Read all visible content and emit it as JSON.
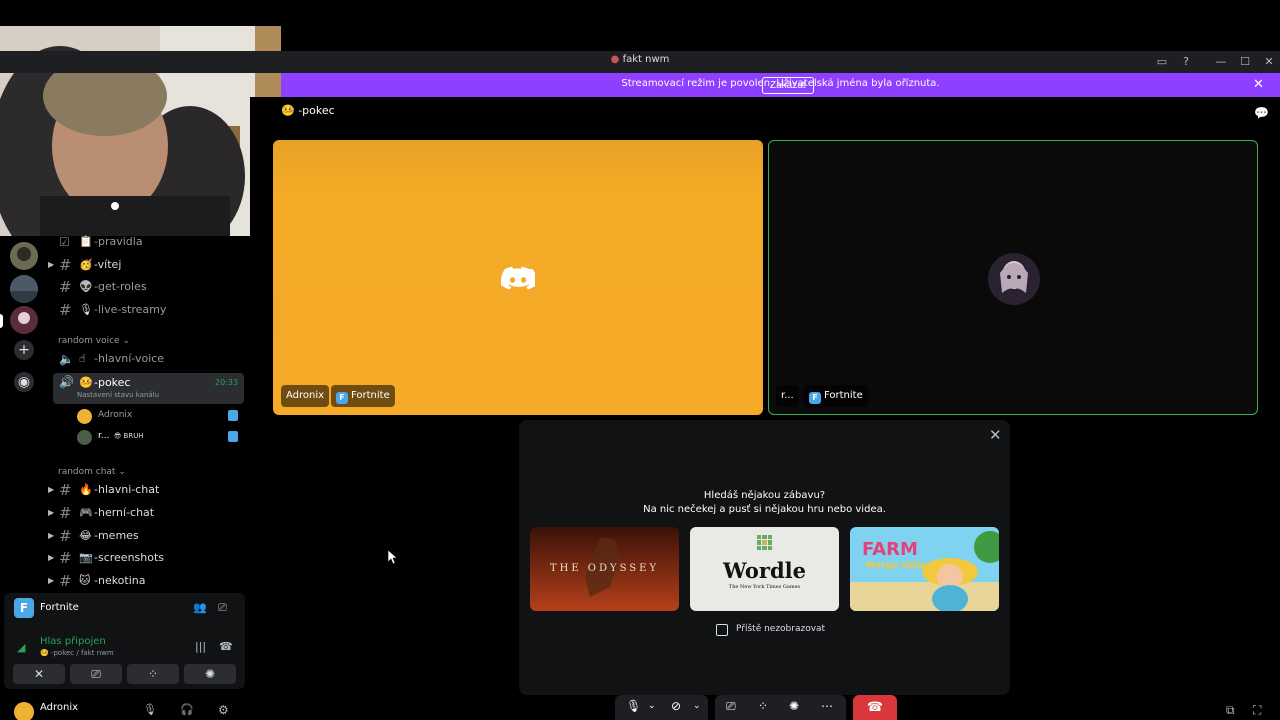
{
  "window": {
    "title": "fakt nwm",
    "title_icon": "server-icon"
  },
  "banner": {
    "text": "Streamovací režim je povolen. Uživatelská jména byla oříznuta.",
    "button": "Zakázat",
    "close": "✕"
  },
  "channels": [
    {
      "emoji": "📋",
      "name": "-pravidla",
      "icon": "rules-icon",
      "arrow": false
    },
    {
      "emoji": "🥳",
      "name": "-vítej",
      "icon": "hash-icon",
      "arrow": true
    },
    {
      "emoji": "👽",
      "name": "-get-roles",
      "icon": "hash-icon",
      "arrow": false
    },
    {
      "emoji": "🎙",
      "name": "-live-streamy",
      "icon": "hash-icon",
      "arrow": false
    }
  ],
  "categories": {
    "voice": "random voice",
    "chat": "random chat"
  },
  "voice_channels": [
    {
      "emoji": "☝",
      "name": "-hlavní-voice"
    },
    {
      "emoji": "🤒",
      "name": "-pokec",
      "time": "20:33",
      "status": "Nastavení stavu kanálu"
    }
  ],
  "voice_users": [
    {
      "name": "Adronix"
    },
    {
      "name": "r...",
      "status": "😎 BRUH"
    }
  ],
  "chat_channels": [
    {
      "emoji": "🔥",
      "name": "-hlavni-chat"
    },
    {
      "emoji": "🎮",
      "name": "-herní-chat"
    },
    {
      "emoji": "😂",
      "name": "-memes"
    },
    {
      "emoji": "📷",
      "name": "-screenshots"
    },
    {
      "emoji": "🐱",
      "name": "-nekotina"
    }
  ],
  "voice_panel": {
    "game": "Fortnite",
    "status": "Hlas připojen",
    "location": "🤒 -pokec / fakt nwm"
  },
  "user": {
    "name": "Adronix",
    "activity": "Fortnite"
  },
  "main": {
    "channel": "-pokec",
    "channel_emoji": "🤒",
    "tiles": [
      {
        "name": "Adronix",
        "game": "Fortnite"
      },
      {
        "name": "r...",
        "game": "Fortnite"
      }
    ]
  },
  "activity": {
    "title": "Hledáš nějakou zábavu?",
    "subtitle": "Na nic nečekej a pusť si nějakou hru nebo videa.",
    "games": [
      {
        "name": "THE ODYSSEY"
      },
      {
        "name": "Wordle",
        "sub": "The New York Times Games"
      },
      {
        "name": "FARM",
        "sub": "Merge Valley"
      }
    ],
    "checkbox": "Příště nezobrazovat"
  },
  "colors": {
    "banner": "#8f3fff",
    "tile_left": "#f5aa28",
    "tile_right_border": "#3fae5c",
    "hangup": "#da373c",
    "voice_green": "#23a55a"
  }
}
